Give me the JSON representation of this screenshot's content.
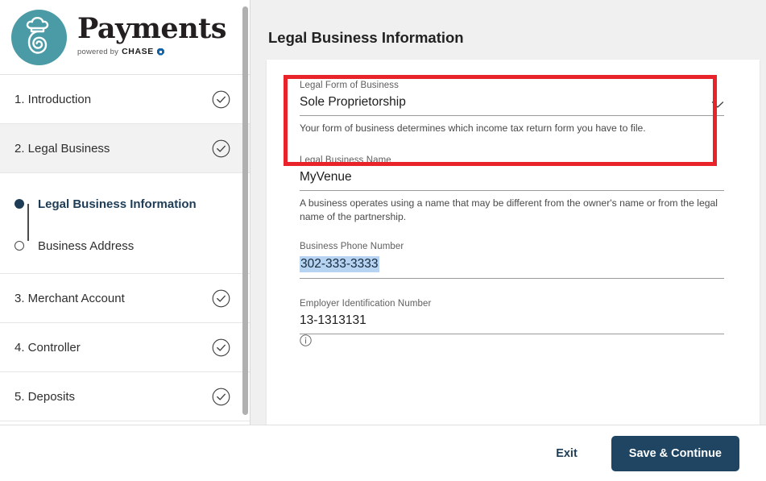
{
  "brand": {
    "title": "Payments",
    "powered_by": "powered by",
    "chase": "CHASE",
    "logo_color": "#4a9ba5",
    "logo_icon": "chef-hat-spiral-icon"
  },
  "sidebar": {
    "steps": [
      {
        "label": "1. Introduction",
        "status_icon": "check-circle-icon",
        "active": false
      },
      {
        "label": "2. Legal Business",
        "status_icon": "check-circle-icon",
        "active": true
      },
      {
        "label": "3. Merchant Account",
        "status_icon": "check-circle-icon",
        "active": false
      },
      {
        "label": "4. Controller",
        "status_icon": "check-circle-icon",
        "active": false
      },
      {
        "label": "5. Deposits",
        "status_icon": "check-circle-icon",
        "active": false
      }
    ],
    "substeps": [
      {
        "label": "Legal Business Information",
        "state": "current"
      },
      {
        "label": "Business Address",
        "state": "pending"
      }
    ]
  },
  "main": {
    "page_title": "Legal Business Information",
    "fields": {
      "legal_form": {
        "label": "Legal Form of Business",
        "value": "Sole Proprietorship",
        "help": "Your form of business determines which income tax return form you have to file.",
        "icon": "chevron-down-icon"
      },
      "business_name": {
        "label": "Legal Business Name",
        "value": "MyVenue",
        "help": "A business operates using a name that may be different from the owner's name or from the legal name of the partnership."
      },
      "phone": {
        "label": "Business Phone Number",
        "value": "302-333-3333",
        "selected": true
      },
      "ein": {
        "label": "Employer Identification Number",
        "value": "13-1313131",
        "icon": "info-circle-icon"
      }
    },
    "annotation_color": "#e8232a"
  },
  "footer": {
    "exit_label": "Exit",
    "save_label": "Save & Continue",
    "primary_color": "#1f4562"
  }
}
